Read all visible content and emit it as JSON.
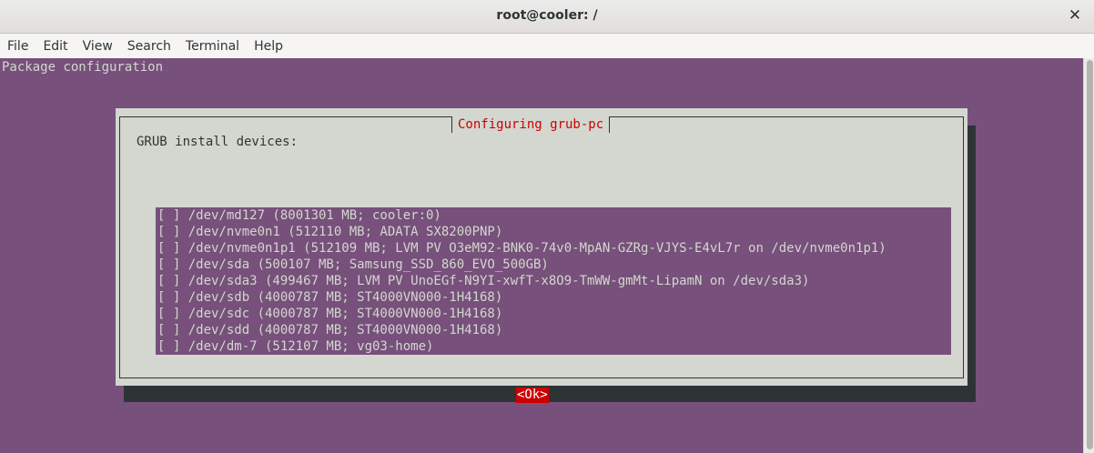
{
  "window": {
    "title": "root@cooler: /",
    "close_glyph": "✕"
  },
  "menu": [
    "File",
    "Edit",
    "View",
    "Search",
    "Terminal",
    "Help"
  ],
  "terminal": {
    "header": "Package configuration",
    "dialog": {
      "title": "Configuring grub-pc",
      "prompt": "GRUB install devices:",
      "items": [
        "[ ] /dev/md127 (8001301 MB; cooler:0)",
        "[ ] /dev/nvme0n1 (512110 MB; ADATA SX8200PNP)",
        "[ ] /dev/nvme0n1p1 (512109 MB; LVM PV O3eM92-BNK0-74v0-MpAN-GZRg-VJYS-E4vL7r on /dev/nvme0n1p1)",
        "[ ] /dev/sda (500107 MB; Samsung_SSD_860_EVO_500GB)",
        "[ ] /dev/sda3 (499467 MB; LVM PV UnoEGf-N9YI-xwfT-x8O9-TmWW-gmMt-LipamN on /dev/sda3)",
        "[ ] /dev/sdb (4000787 MB; ST4000VN000-1H4168)",
        "[ ] /dev/sdc (4000787 MB; ST4000VN000-1H4168)",
        "[ ] /dev/sdd (4000787 MB; ST4000VN000-1H4168)",
        "[ ] /dev/dm-7 (512107 MB; vg03-home)"
      ],
      "ok_label": "<Ok>"
    }
  },
  "colors": {
    "terminal_bg": "#77507b",
    "dialog_bg": "#d3d7cf",
    "dialog_title": "#cc0000",
    "ok_bg": "#cc0000"
  }
}
